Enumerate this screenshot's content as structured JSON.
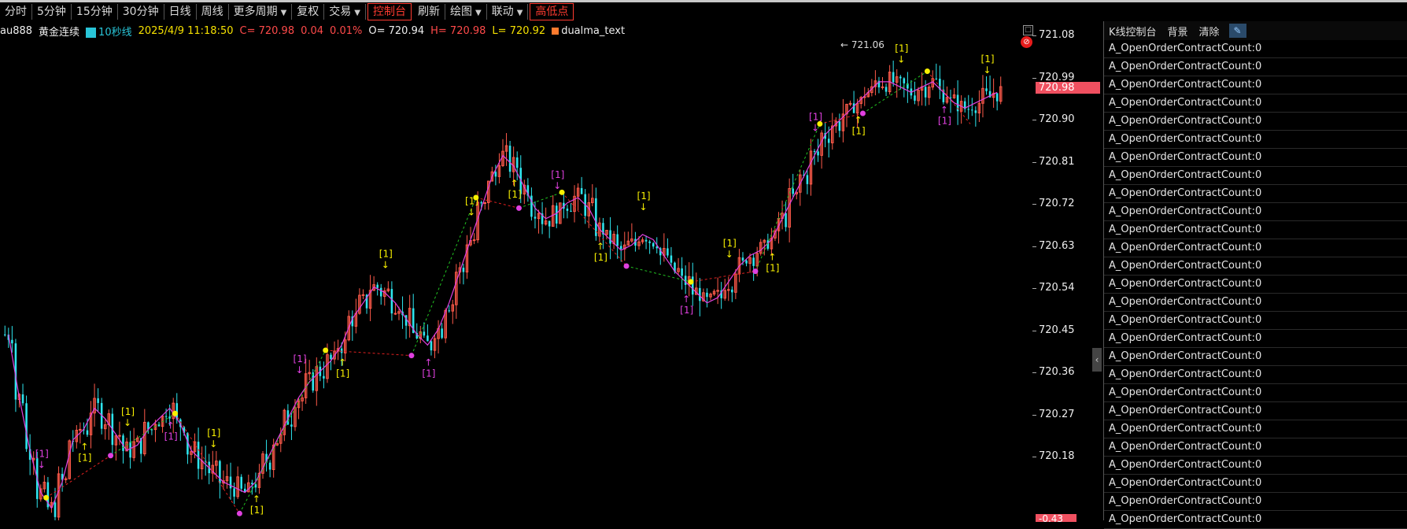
{
  "toolbar": {
    "items": [
      {
        "label": "分时",
        "dropdown": false,
        "highlight": false
      },
      {
        "label": "5分钟",
        "dropdown": false,
        "highlight": false
      },
      {
        "label": "15分钟",
        "dropdown": false,
        "highlight": false
      },
      {
        "label": "30分钟",
        "dropdown": false,
        "highlight": false
      },
      {
        "label": "日线",
        "dropdown": false,
        "highlight": false
      },
      {
        "label": "周线",
        "dropdown": false,
        "highlight": false
      },
      {
        "label": "更多周期",
        "dropdown": true,
        "highlight": false
      },
      {
        "label": "复权",
        "dropdown": false,
        "highlight": false
      },
      {
        "label": "交易",
        "dropdown": true,
        "highlight": false
      },
      {
        "label": "控制台",
        "dropdown": false,
        "highlight": true
      },
      {
        "label": "刷新",
        "dropdown": false,
        "highlight": false
      },
      {
        "label": "绘图",
        "dropdown": true,
        "highlight": false
      },
      {
        "label": "联动",
        "dropdown": true,
        "highlight": false
      },
      {
        "label": "高低点",
        "dropdown": false,
        "highlight": true
      }
    ]
  },
  "info": {
    "symbol": "au888",
    "name": "黄金连续",
    "period": "10秒线",
    "datetime": "2025/4/9 11:18:50",
    "close": "C= 720.98",
    "change": "0.04",
    "pct": "0.01%",
    "open_label": "O=",
    "open": "720.94",
    "high": "H= 720.98",
    "low": "L= 720.92",
    "indicator": "dualma_text"
  },
  "yaxis": {
    "ticks": [
      "721.08",
      "720.99",
      "720.90",
      "720.81",
      "720.72",
      "720.63",
      "720.54",
      "720.45",
      "720.36",
      "720.27",
      "720.18"
    ],
    "current_price": "720.98",
    "bottom_badge": "-0.43"
  },
  "chart_annotations": {
    "hline_label": "721.06",
    "marker_text": "[1]"
  },
  "colors": {
    "up": "#ff5a4a",
    "down": "#2ee6ef",
    "ma": "#e040e0",
    "marker_yellow": "#f8f000",
    "marker_magenta": "#e040e0",
    "badge": "#f05060"
  },
  "side_panel": {
    "tabs": [
      "K线控制台",
      "背景",
      "清除"
    ],
    "rows": [
      "A_OpenOrderContractCount:0",
      "A_OpenOrderContractCount:0",
      "A_OpenOrderContractCount:0",
      "A_OpenOrderContractCount:0",
      "A_OpenOrderContractCount:0",
      "A_OpenOrderContractCount:0",
      "A_OpenOrderContractCount:0",
      "A_OpenOrderContractCount:0",
      "A_OpenOrderContractCount:0",
      "A_OpenOrderContractCount:0",
      "A_OpenOrderContractCount:0",
      "A_OpenOrderContractCount:0",
      "A_OpenOrderContractCount:0",
      "A_OpenOrderContractCount:0",
      "A_OpenOrderContractCount:0",
      "A_OpenOrderContractCount:0",
      "A_OpenOrderContractCount:0",
      "A_OpenOrderContractCount:0",
      "A_OpenOrderContractCount:0",
      "A_OpenOrderContractCount:0",
      "A_OpenOrderContractCount:0",
      "A_OpenOrderContractCount:0",
      "A_OpenOrderContractCount:0",
      "A_OpenOrderContractCount:0",
      "A_OpenOrderContractCount:0",
      "A_OpenOrderContractCount:0",
      "A_OpenOrderContractCount:0"
    ]
  },
  "chart_data": {
    "type": "line",
    "title": "",
    "ylim": [
      720.17,
      721.1
    ],
    "series": [
      {
        "values": [
          720.52,
          720.4,
          720.3,
          720.22,
          720.19,
          720.24,
          720.32,
          720.34,
          720.38,
          720.36,
          720.33,
          720.3,
          720.31,
          720.34,
          720.36,
          720.38,
          720.35,
          720.3,
          720.28,
          720.26,
          720.24,
          720.23,
          720.22,
          720.24,
          720.28,
          720.32,
          720.36,
          720.4,
          720.43,
          720.45,
          720.47,
          720.5,
          720.55,
          720.58,
          720.61,
          720.6,
          720.58,
          720.55,
          720.52,
          720.5,
          720.53,
          720.58,
          720.64,
          720.7,
          720.76,
          720.82,
          720.86,
          720.84,
          720.8,
          720.76,
          720.74,
          720.75,
          720.77,
          720.78,
          720.76,
          720.72,
          720.7,
          720.68,
          720.69,
          720.71,
          720.7,
          720.67,
          720.64,
          720.62,
          720.6,
          720.58,
          720.59,
          720.62,
          720.65,
          720.67,
          720.68,
          720.7,
          720.74,
          720.78,
          720.82,
          720.86,
          720.9,
          720.92,
          720.94,
          720.96,
          720.98,
          721.0,
          721.0,
          720.99,
          720.98,
          720.99,
          721.0,
          720.98,
          720.96,
          720.95,
          720.96,
          720.97,
          720.98
        ]
      }
    ]
  }
}
